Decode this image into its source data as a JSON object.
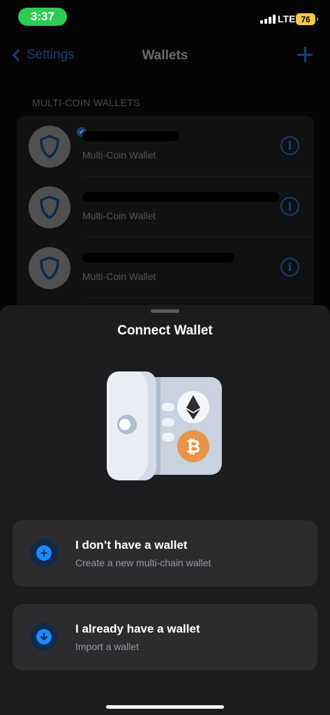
{
  "status_bar": {
    "time": "3:37",
    "network": "LTE",
    "battery": "76",
    "time_pill_color": "#2ecc52"
  },
  "nav": {
    "back_label": "Settings",
    "title": "Wallets",
    "add_icon": "plus-icon"
  },
  "wallets": {
    "section_label": "MULTI-COIN WALLETS",
    "items": [
      {
        "name": "",
        "subtitle": "Multi-Coin Wallet",
        "selected": true
      },
      {
        "name": "",
        "subtitle": "Multi-Coin Wallet",
        "selected": false
      },
      {
        "name": "",
        "subtitle": "Multi-Coin Wallet",
        "selected": false
      }
    ]
  },
  "sheet": {
    "title": "Connect Wallet",
    "illustration": "wallet-safe-illustration",
    "options": [
      {
        "title": "I don’t have a wallet",
        "subtitle": "Create a new multi-chain wallet",
        "icon": "plus-circle-icon"
      },
      {
        "title": "I already have a wallet",
        "subtitle": "Import a wallet",
        "icon": "download-arrow-icon"
      }
    ]
  },
  "colors": {
    "accent": "#1e88ff",
    "sheet_bg": "#1c1c1e",
    "card_bg": "#2c2c2e",
    "ethereum": "#2f2f2f",
    "bitcoin": "#e8954a"
  }
}
